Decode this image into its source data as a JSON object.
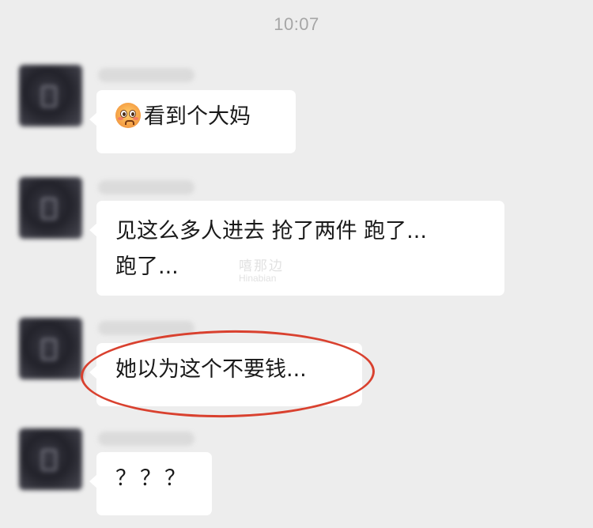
{
  "chat": {
    "timestamp": "10:07",
    "messages": [
      {
        "text": "看到个大妈",
        "emoji": "flushed-face-emoji"
      },
      {
        "line1": "见这么多人进去 抢了两件 跑了...",
        "line2": "跑了..."
      },
      {
        "text": "她以为这个不要钱..."
      },
      {
        "text": "？？？"
      }
    ]
  },
  "watermark": {
    "cn": "嘻那边",
    "en": "Hinabian"
  },
  "annotation": {
    "color": "#d9412f"
  },
  "colors": {
    "background": "#ededed",
    "bubble": "#ffffff",
    "timestamp": "#a6a6a6"
  }
}
